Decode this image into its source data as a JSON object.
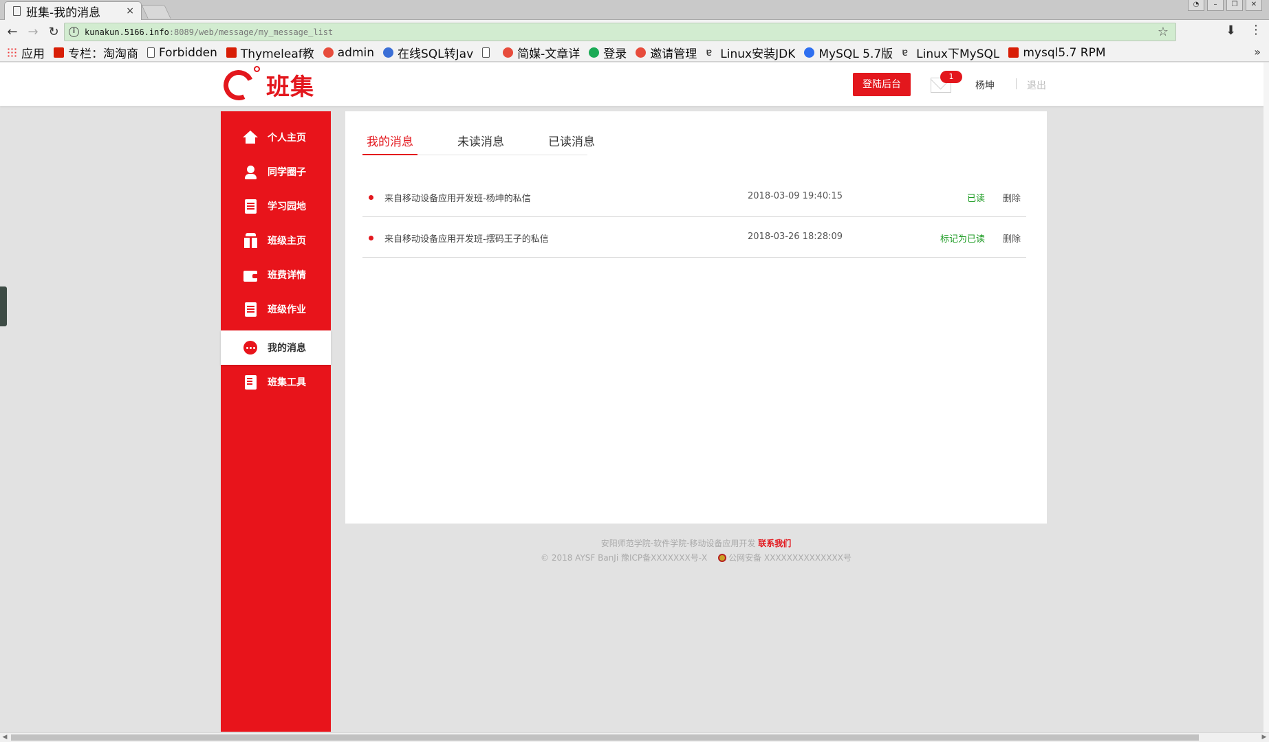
{
  "browser": {
    "tab_title": "班集-我的消息",
    "tab_close": "×",
    "url_host": "kunakun.5166.info",
    "url_path": ":8089/web/message/my_message_list",
    "bookmarks": [
      {
        "label": "应用",
        "icon": "apps-grid-icon"
      },
      {
        "label": "专栏：淘淘商",
        "icon": "csdn-icon"
      },
      {
        "label": "Forbidden",
        "icon": "page-icon"
      },
      {
        "label": "Thymeleaf教",
        "icon": "csdn-icon"
      },
      {
        "label": "admin",
        "icon": "jm-icon"
      },
      {
        "label": "在线SQL转Jav",
        "icon": "code-icon"
      },
      {
        "label": "",
        "icon": "page-icon"
      },
      {
        "label": "简媒-文章详",
        "icon": "jm-icon"
      },
      {
        "label": "登录",
        "icon": "green-icon"
      },
      {
        "label": "邀请管理",
        "icon": "jm-icon"
      },
      {
        "label": "Linux安装JDK",
        "icon": "a-icon"
      },
      {
        "label": "MySQL 5.7版",
        "icon": "paw-icon"
      },
      {
        "label": "Linux下MySQL",
        "icon": "a-icon"
      },
      {
        "label": "mysql5.7 RPM",
        "icon": "csdn-icon"
      }
    ],
    "more": "»"
  },
  "header": {
    "logo_text": "班集",
    "admin_button": "登陆后台",
    "unread_count": "1",
    "user_name": "杨坤",
    "logout": "退出"
  },
  "sidebar": {
    "items": [
      {
        "label": "个人主页",
        "icon": "home-icon"
      },
      {
        "label": "同学圈子",
        "icon": "user-icon"
      },
      {
        "label": "学习园地",
        "icon": "document-icon"
      },
      {
        "label": "班级主页",
        "icon": "gift-icon"
      },
      {
        "label": "班费详情",
        "icon": "wallet-icon"
      },
      {
        "label": "班级作业",
        "icon": "document-icon"
      },
      {
        "label": "我的消息",
        "icon": "chat-icon",
        "active": true
      },
      {
        "label": "班集工具",
        "icon": "tool-icon"
      }
    ]
  },
  "main": {
    "tabs": [
      {
        "label": "我的消息",
        "active": true
      },
      {
        "label": "未读消息"
      },
      {
        "label": "已读消息"
      }
    ],
    "messages": [
      {
        "title": "来自移动设备应用开发班-杨坤的私信",
        "time": "2018-03-09 19:40:15",
        "status": "已读",
        "delete": "删除"
      },
      {
        "title": "来自移动设备应用开发班-摆码王子的私信",
        "time": "2018-03-26 18:28:09",
        "status": "标记为已读",
        "delete": "删除"
      }
    ]
  },
  "footer": {
    "line1": "安阳师范学院-软件学院-移动设备应用开发",
    "contact": "联系我们",
    "copyright": "© 2018 AYSF BanJi 豫ICP备XXXXXXX号-X",
    "police": "公网安备 XXXXXXXXXXXXXX号"
  },
  "colors": {
    "brand": "#e3171d",
    "read_status": "#1a9a20"
  }
}
